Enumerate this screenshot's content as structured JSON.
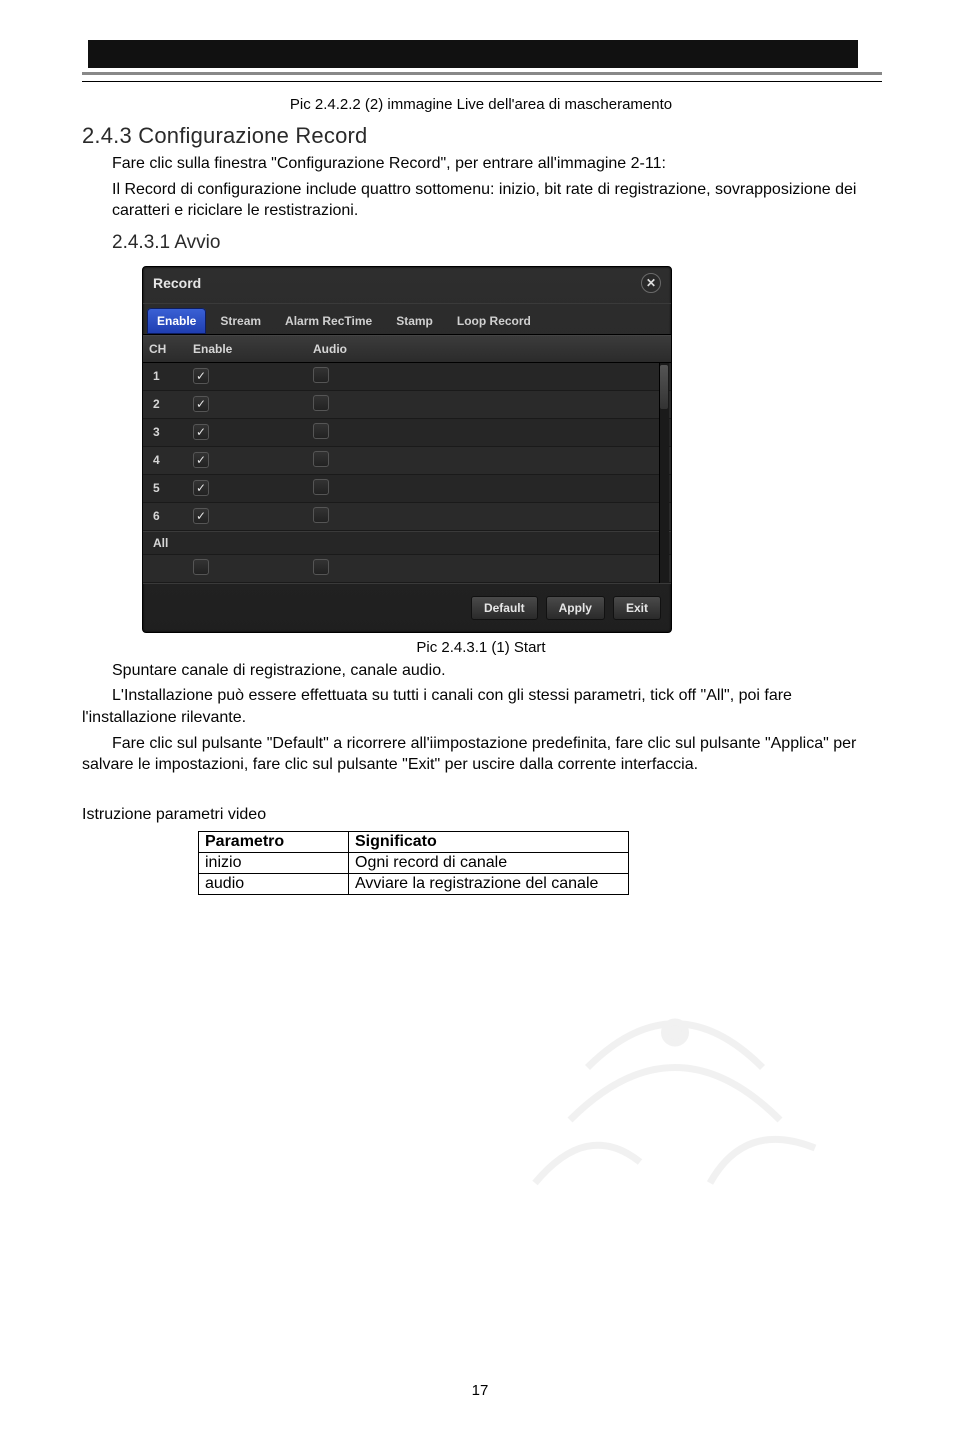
{
  "caption_top": "Pic 2.4.2.2 (2) immagine Live dell'area di mascheramento",
  "h2": "2.4.3 Configurazione Record",
  "p1": "Fare clic sulla finestra \"Configurazione Record\", per entrare all'immagine 2-11:",
  "p2": "Il Record di configurazione include quattro sottomenu: inizio, bit rate di registrazione, sovrapposizione dei caratteri e riciclare le restistrazioni.",
  "h3": "2.4.3.1 Avvio",
  "dialog": {
    "title": "Record",
    "tabs": [
      "Enable",
      "Stream",
      "Alarm RecTime",
      "Stamp",
      "Loop Record"
    ],
    "active_tab": 0,
    "columns": [
      "CH",
      "Enable",
      "Audio"
    ],
    "rows": [
      {
        "ch": "1",
        "enable": true,
        "audio": false
      },
      {
        "ch": "2",
        "enable": true,
        "audio": false
      },
      {
        "ch": "3",
        "enable": true,
        "audio": false
      },
      {
        "ch": "4",
        "enable": true,
        "audio": false
      },
      {
        "ch": "5",
        "enable": true,
        "audio": false
      },
      {
        "ch": "6",
        "enable": true,
        "audio": false
      }
    ],
    "all_row": {
      "label": "All",
      "enable": false,
      "audio": false
    },
    "buttons": {
      "default": "Default",
      "apply": "Apply",
      "exit": "Exit"
    }
  },
  "caption_fig": "Pic 2.4.3.1 (1) Start",
  "p3": "Spuntare canale di registrazione, canale audio.",
  "p4": "L'Installazione può essere effettuata su tutti i canali con gli stessi parametri, tick off \"All\", poi fare l'installazione rilevante.",
  "p5": "Fare clic sul pulsante \"Default\" a ricorrere all'iimpostazione predefinita, fare clic sul pulsante \"Applica\" per salvare le impostazioni, fare clic sul pulsante \"Exit\" per uscire dalla corrente interfaccia.",
  "instr_heading": "Istruzione parametri video",
  "param_table": {
    "headers": [
      "Parametro",
      "Significato"
    ],
    "rows": [
      [
        "inizio",
        "Ogni   record di canale"
      ],
      [
        "audio",
        "Avviare la registrazione del canale"
      ]
    ]
  },
  "page_number": "17"
}
